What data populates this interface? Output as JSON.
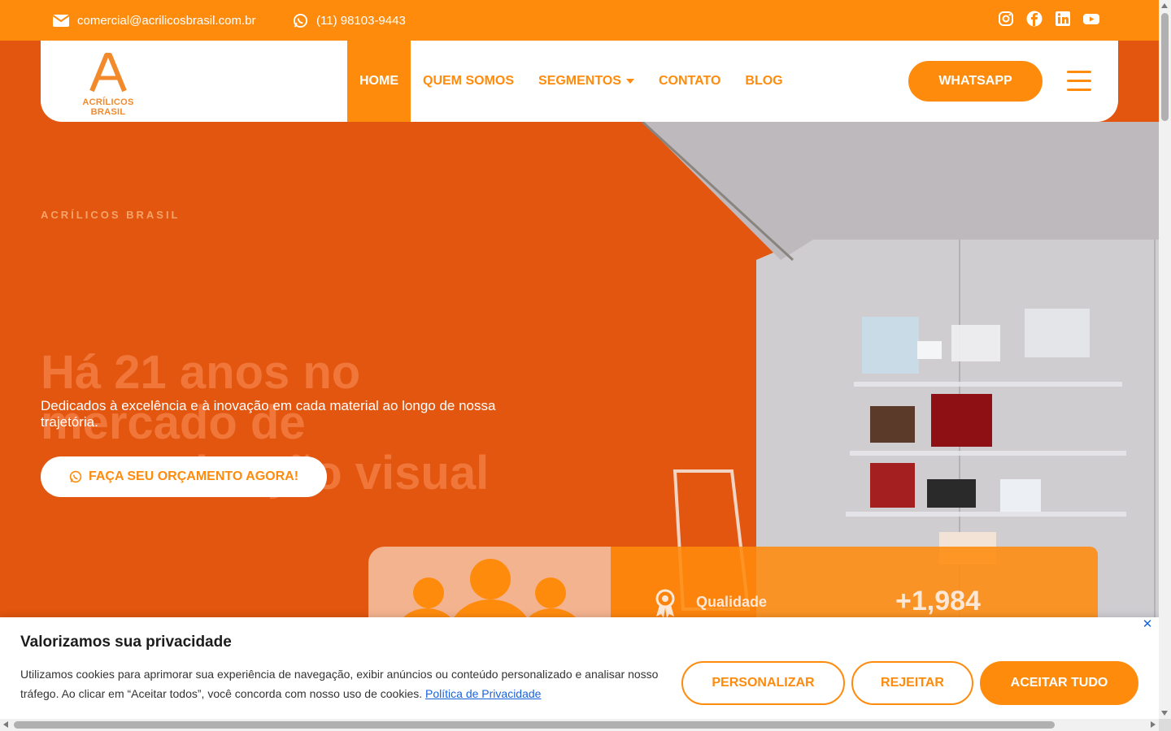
{
  "topbar": {
    "email": "comercial@acrilicosbrasil.com.br",
    "phone": "(11) 98103-9443",
    "social_icons": [
      "instagram-icon",
      "facebook-icon",
      "linkedin-icon",
      "youtube-icon"
    ]
  },
  "header": {
    "logo_text": "ACRÍLICOS BRASIL",
    "nav": [
      {
        "label": "HOME",
        "active": true
      },
      {
        "label": "QUEM SOMOS"
      },
      {
        "label": "SEGMENTOS",
        "has_dropdown": true
      },
      {
        "label": "CONTATO"
      },
      {
        "label": "BLOG"
      }
    ],
    "whatsapp_label": "WHATSAPP"
  },
  "hero": {
    "eyebrow": "ACRÍLICOS BRASIL",
    "headline": "Há 21 anos no mercado de comunicação visual",
    "subtitle": "Dedicados à excelência e à inovação em cada material ao longo de nossa trajetória.",
    "cta_label": "FAÇA SEU ORÇAMENTO AGORA!",
    "stats": {
      "quality_label": "Qualidade",
      "count": "+1,984"
    }
  },
  "cookie": {
    "title": "Valorizamos sua privacidade",
    "text": "Utilizamos cookies para aprimorar sua experiência de navegação, exibir anúncios ou conteúdo personalizado e analisar nosso tráfego. Ao clicar em “Aceitar todos”, você concorda com nosso uso de cookies.",
    "policy_link": "Política de Privacidade",
    "customize_label": "PERSONALIZAR",
    "reject_label": "REJEITAR",
    "accept_label": "ACEITAR TUDO",
    "close_symbol": "✕"
  },
  "colors": {
    "brand_orange": "#ff8b0d",
    "hero_orange": "#e2560f",
    "link_blue": "#1863dc"
  }
}
